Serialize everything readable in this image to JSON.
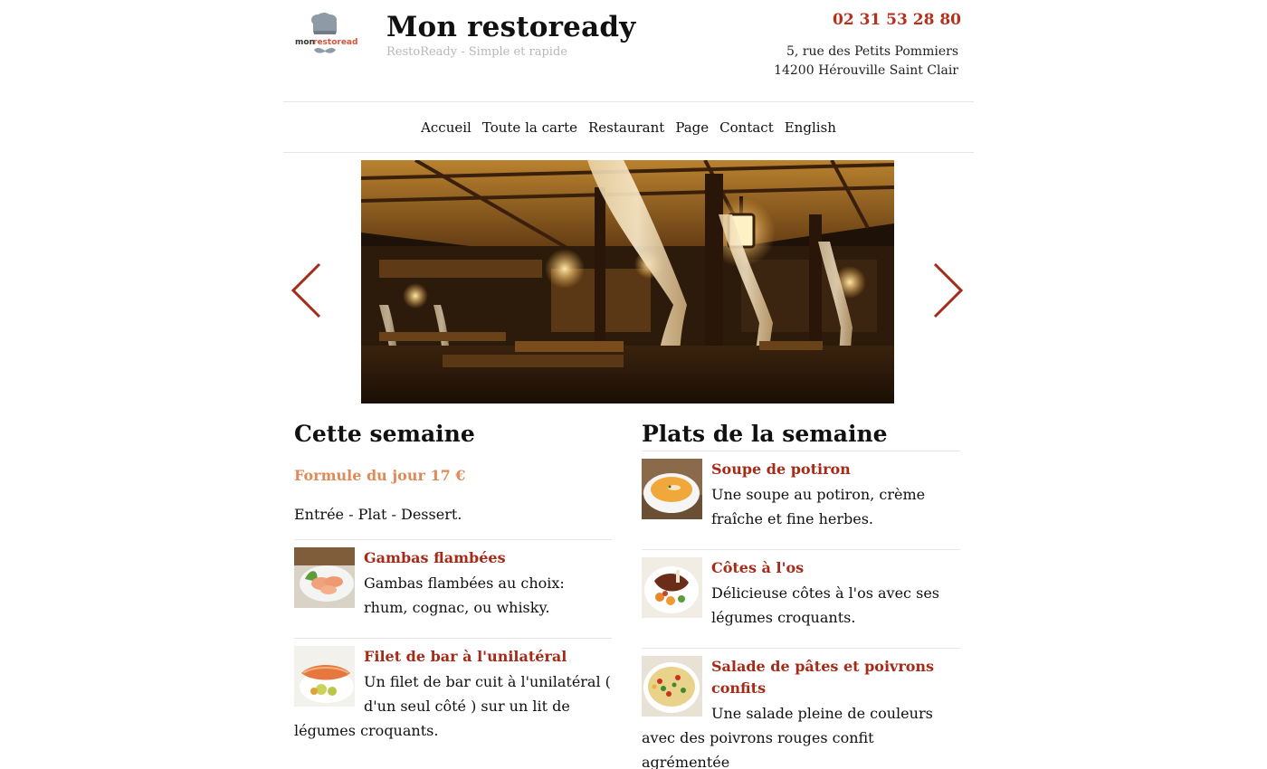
{
  "header": {
    "site_title": "Mon restoready",
    "tagline": "RestoReady - Simple et rapide",
    "phone": "02 31 53 28 80",
    "address_line1": "5, rue des Petits Pommiers",
    "address_line2": "14200 Hérouville Saint Clair",
    "logo_word_mon": "mon",
    "logo_word_resto": "restoready"
  },
  "nav": {
    "items": [
      {
        "label": "Accueil"
      },
      {
        "label": "Toute la carte"
      },
      {
        "label": "Restaurant"
      },
      {
        "label": "Page"
      },
      {
        "label": "Contact"
      },
      {
        "label": "English"
      }
    ]
  },
  "slider": {
    "prev_icon": "chevron-left-icon",
    "next_icon": "chevron-right-icon",
    "image_subject": "restaurant-interior"
  },
  "left_column": {
    "title": "Cette semaine",
    "formule_title": "Formule du jour 17 €",
    "formule_desc": "Entrée - Plat - Dessert.",
    "dishes": [
      {
        "name": "Gambas flambées",
        "desc": "Gambas flambées au choix: rhum, cognac, ou whisky."
      },
      {
        "name": "Filet de bar à l'unilatéral",
        "desc": "Un filet de bar cuit à l'unilatéral ( d'un seul côté ) sur un lit de légumes croquants."
      }
    ]
  },
  "right_column": {
    "title": "Plats de la semaine",
    "dishes": [
      {
        "name": "Soupe de potiron",
        "desc": "Une soupe au potiron, crème fraîche et fine herbes."
      },
      {
        "name": "Côtes à l'os",
        "desc": "Délicieuse côtes à l'os avec ses légumes croquants."
      },
      {
        "name": "Salade de pâtes et poivrons confits",
        "desc": "Une salade pleine de couleurs avec des poivrons rouges confit agrémentée"
      }
    ]
  },
  "colors": {
    "accent": "#b6301c",
    "dish_title": "#a52a17",
    "formule": "#e08a57",
    "tagline": "#b8b8b8"
  }
}
